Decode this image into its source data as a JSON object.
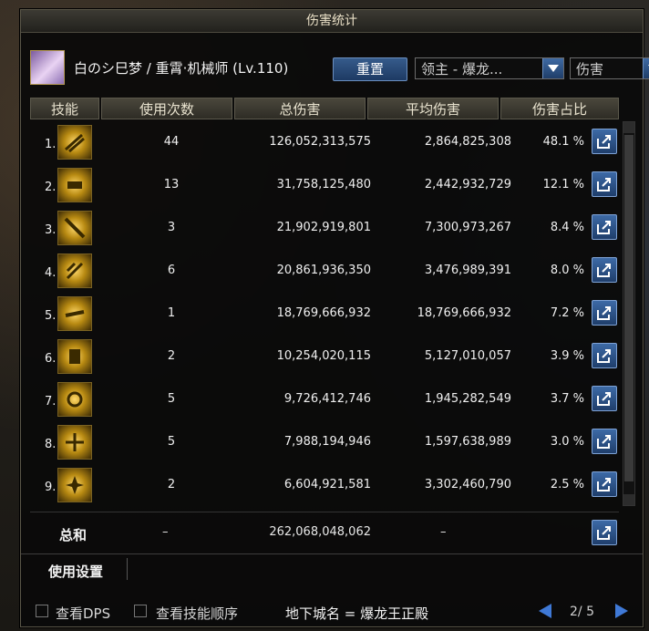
{
  "window": {
    "title": "伤害统计"
  },
  "character": {
    "name": "白のシ巳梦 / 重霄·机械师 (Lv.110)"
  },
  "controls": {
    "reset_label": "重置",
    "dungeon_select": "领主 - 爆龙...",
    "metric_select": "伤害"
  },
  "columns": [
    "技能",
    "使用次数",
    "总伤害",
    "平均伤害",
    "伤害占比"
  ],
  "rows": [
    {
      "rank": "1.",
      "count": "44",
      "total": "126,052,313,575",
      "avg": "2,864,825,308",
      "pct": "48.1 %"
    },
    {
      "rank": "2.",
      "count": "13",
      "total": "31,758,125,480",
      "avg": "2,442,932,729",
      "pct": "12.1 %"
    },
    {
      "rank": "3.",
      "count": "3",
      "total": "21,902,919,801",
      "avg": "7,300,973,267",
      "pct": "8.4 %"
    },
    {
      "rank": "4.",
      "count": "6",
      "total": "20,861,936,350",
      "avg": "3,476,989,391",
      "pct": "8.0 %"
    },
    {
      "rank": "5.",
      "count": "1",
      "total": "18,769,666,932",
      "avg": "18,769,666,932",
      "pct": "7.2 %"
    },
    {
      "rank": "6.",
      "count": "2",
      "total": "10,254,020,115",
      "avg": "5,127,010,057",
      "pct": "3.9 %"
    },
    {
      "rank": "7.",
      "count": "5",
      "total": "9,726,412,746",
      "avg": "1,945,282,549",
      "pct": "3.7 %"
    },
    {
      "rank": "8.",
      "count": "5",
      "total": "7,988,194,946",
      "avg": "1,597,638,989",
      "pct": "3.0 %"
    },
    {
      "rank": "9.",
      "count": "2",
      "total": "6,604,921,581",
      "avg": "3,302,460,790",
      "pct": "2.5 %"
    }
  ],
  "total": {
    "label": "总和",
    "count": "–",
    "total": "262,068,048,062",
    "avg": "–"
  },
  "settings": {
    "label": "使用设置"
  },
  "bottom": {
    "show_dps": "查看DPS",
    "show_skill_order": "查看技能顺序",
    "dungeon": "地下城名 = 爆龙王正殿",
    "page": "2/ 5"
  }
}
